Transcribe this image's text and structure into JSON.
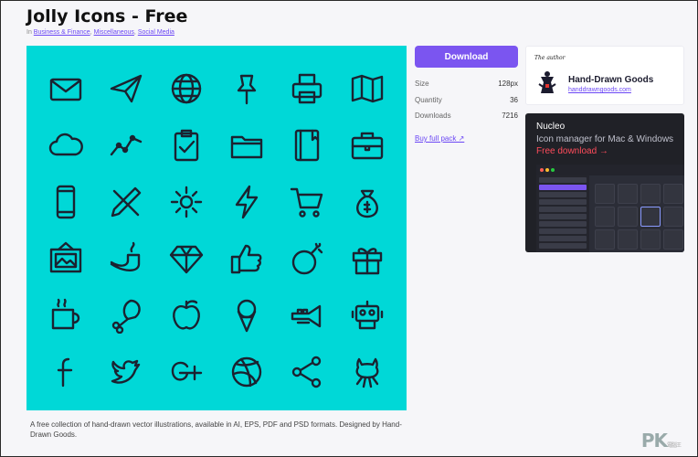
{
  "page": {
    "title": "Jolly Icons - Free"
  },
  "categories": {
    "prefix": "In",
    "items": [
      "Business & Finance",
      "Miscellaneous",
      "Social Media"
    ]
  },
  "preview": {
    "background": "#00d8d7",
    "icons": [
      "envelope-icon",
      "paper-plane-icon",
      "globe-icon",
      "pushpin-icon",
      "printer-icon",
      "map-icon",
      "cloud-icon",
      "line-graph-icon",
      "clipboard-check-icon",
      "folder-icon",
      "notebook-icon",
      "briefcase-icon",
      "smartphone-icon",
      "tools-icon",
      "gear-icon",
      "lightning-icon",
      "shopping-cart-icon",
      "money-bag-icon",
      "picture-frame-icon",
      "tobacco-pipe-icon",
      "diamond-icon",
      "thumbs-up-icon",
      "bomb-icon",
      "gift-icon",
      "coffee-mug-icon",
      "chicken-leg-icon",
      "apple-icon",
      "ice-cream-icon",
      "trumpet-icon",
      "robot-icon",
      "facebook-icon",
      "twitter-icon",
      "google-plus-icon",
      "dribbble-icon",
      "share-icon",
      "github-octocat-icon"
    ]
  },
  "description": "A free collection of hand-drawn vector illustrations, available in AI, EPS, PDF and PSD formats. Designed by Hand-Drawn Goods.",
  "sidebar": {
    "download_label": "Download",
    "stats": [
      {
        "label": "Size",
        "value": "128px"
      },
      {
        "label": "Quantity",
        "value": "36"
      },
      {
        "label": "Downloads",
        "value": "7216"
      }
    ],
    "buy_label": "Buy full pack ↗"
  },
  "author": {
    "caption": "The author",
    "name": "Hand-Drawn Goods",
    "site": "handdrawngoods.com"
  },
  "ad": {
    "headline": "Nucleo",
    "tagline": "Icon manager for Mac & Windows",
    "cta": "Free download →",
    "accent": "#ff4c5b"
  },
  "brand": {
    "accent": "#7b55f0"
  },
  "watermark": {
    "main": "PK",
    "small": "電腦王"
  }
}
